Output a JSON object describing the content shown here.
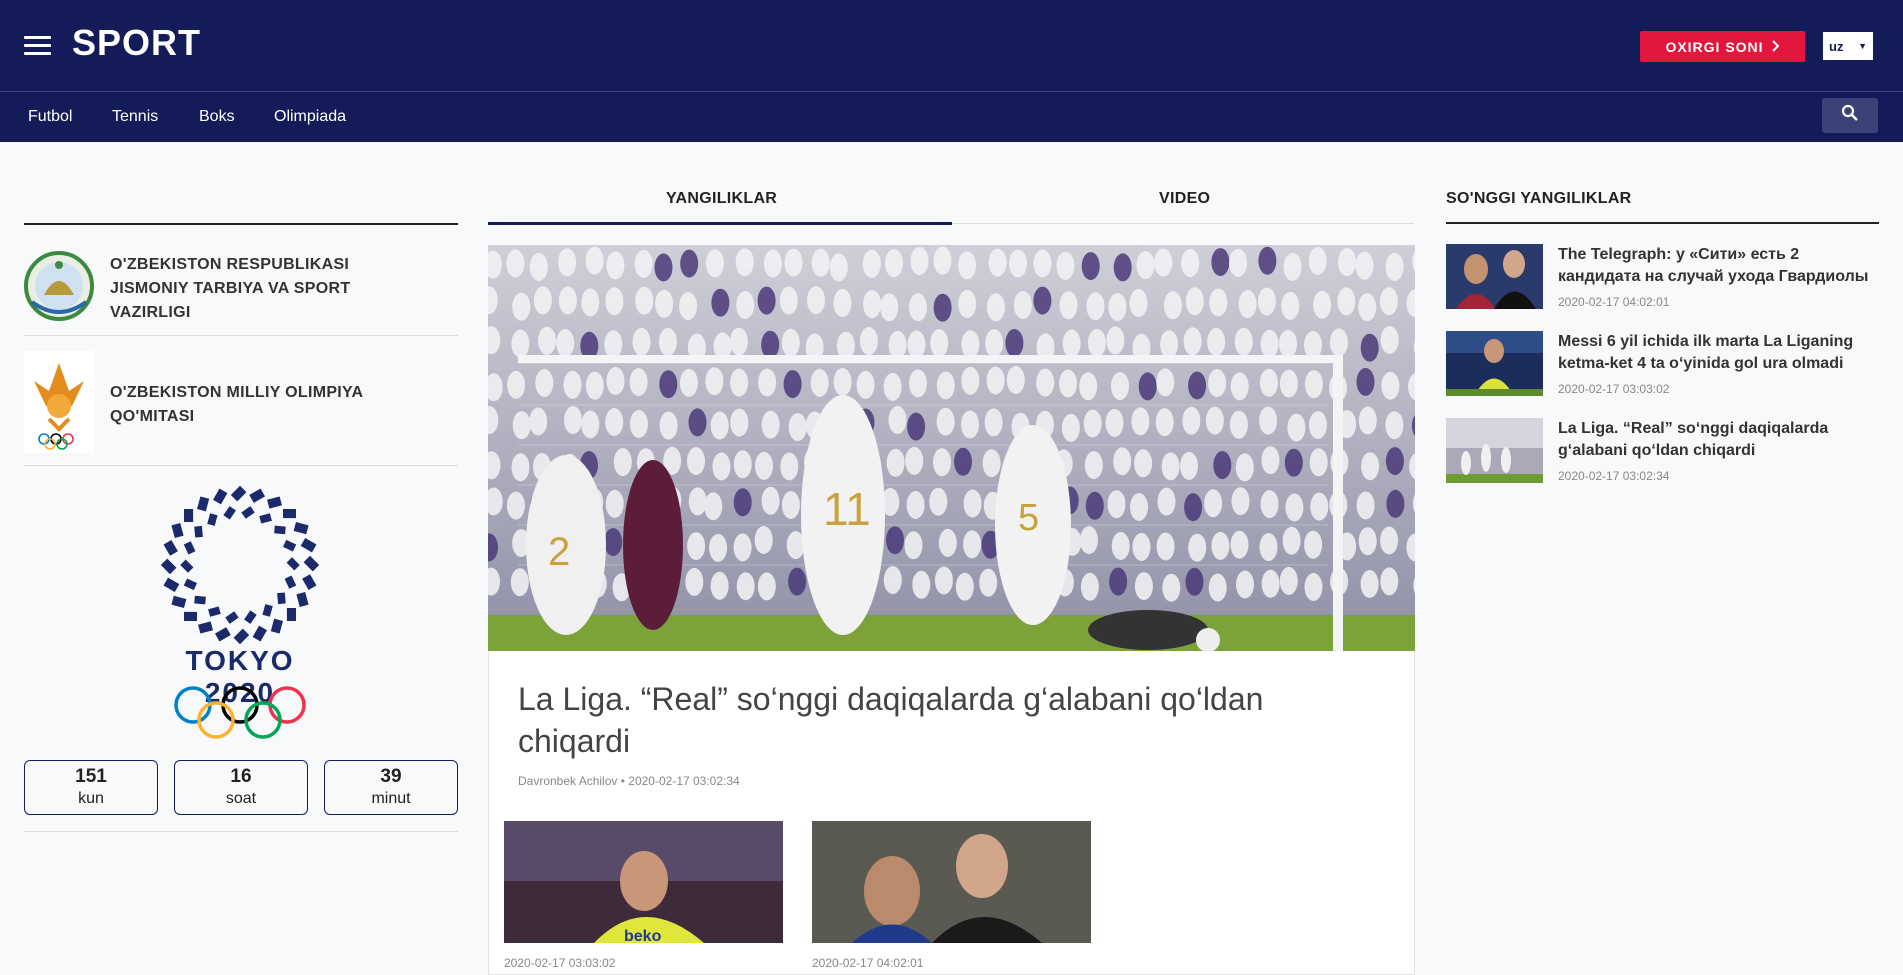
{
  "header": {
    "logo": "SPORT",
    "latest_button": "OXIRGI SONI",
    "language": "uz",
    "nav": [
      "Futbol",
      "Tennis",
      "Boks",
      "Olimpiada"
    ],
    "brand_color": "#131c58",
    "accent_color": "#e2173d"
  },
  "left": {
    "orgs": [
      {
        "name": "O'ZBEKISTON RESPUBLIKASI JISMONIY TARBIYA VA SPORT VAZIRLIGI"
      },
      {
        "name": "O'ZBEKISTON MILLIY OLIMPIYA QO'MITASI"
      }
    ],
    "tokyo_text": "TOKYO 2020",
    "countdown": [
      {
        "value": "151",
        "unit": "kun"
      },
      {
        "value": "16",
        "unit": "soat"
      },
      {
        "value": "39",
        "unit": "minut"
      }
    ]
  },
  "center": {
    "tabs": [
      "YANGILIKLAR",
      "VIDEO"
    ],
    "headline": "La Liga. “Real” so‘nggi daqiqalarda g‘alabani qo‘ldan chiqardi",
    "author": "Davronbek Achilov",
    "date": "2020-02-17 03:02:34",
    "thumbs": [
      {
        "date": "2020-02-17 03:03:02"
      },
      {
        "date": "2020-02-17 04:02:01"
      }
    ]
  },
  "right": {
    "title": "SO'NGGI YANGILIKLAR",
    "items": [
      {
        "title": "The Telegraph: у «Сити» есть 2 кандидата на случай ухода Гвардиолы",
        "date": "2020-02-17 04:02:01"
      },
      {
        "title": "Messi 6 yil ichida ilk marta La Liganing ketma-ket 4 ta o‘yinida gol ura olmadi",
        "date": "2020-02-17 03:03:02"
      },
      {
        "title": "La Liga. “Real” so‘nggi daqiqalarda g‘alabani qo‘ldan chiqardi",
        "date": "2020-02-17 03:02:34"
      }
    ]
  }
}
